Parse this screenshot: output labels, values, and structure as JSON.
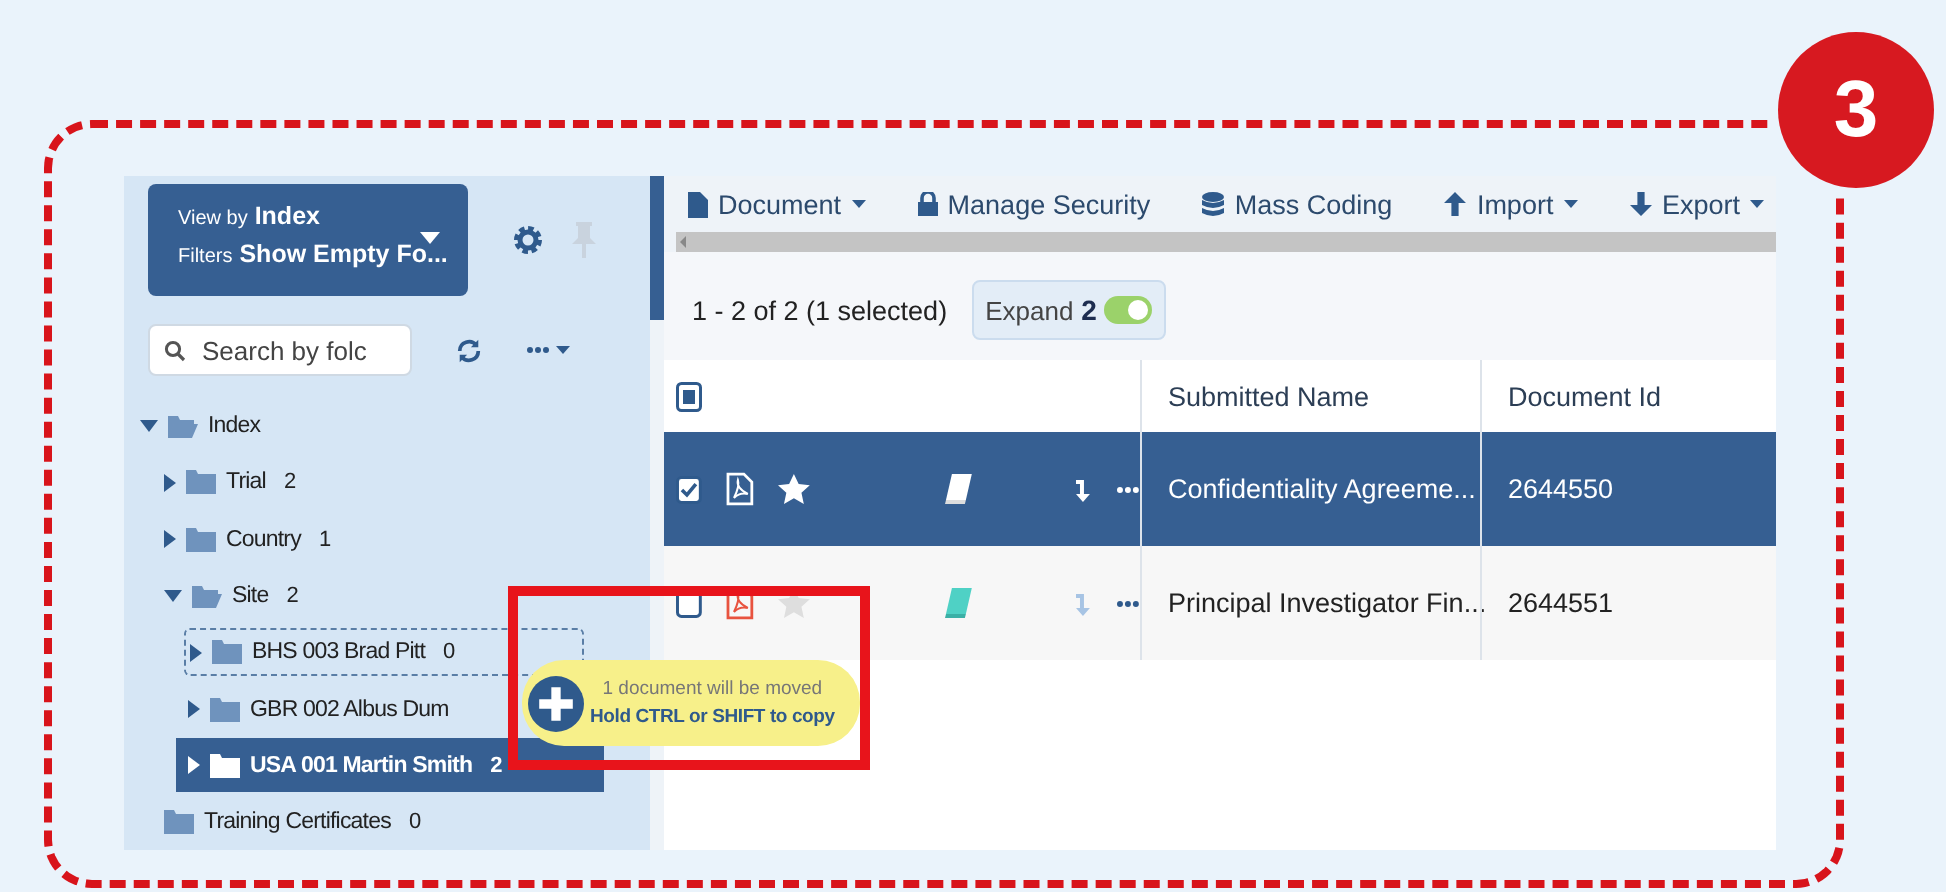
{
  "step_badge": "3",
  "view": {
    "view_by_label": "View by",
    "view_by": "Index",
    "filters_label": "Filters",
    "filters": "Show Empty Fo..."
  },
  "search": {
    "placeholder": "Search by folc"
  },
  "tree": [
    {
      "label": "Index",
      "expanded": true,
      "selected": false,
      "drop_target": false,
      "children": [
        {
          "label": "Trial",
          "count": "2",
          "expanded": false,
          "selected": false,
          "drop_target": false
        },
        {
          "label": "Country",
          "count": "1",
          "expanded": false,
          "selected": false,
          "drop_target": false
        },
        {
          "label": "Site",
          "count": "2",
          "expanded": true,
          "selected": false,
          "drop_target": false,
          "children": [
            {
              "label": "BHS 003 Brad Pitt",
              "count": "0",
              "expanded": false,
              "selected": false,
              "drop_target": true
            },
            {
              "label": "GBR 002 Albus Dum",
              "expanded": false,
              "selected": false,
              "drop_target": false
            },
            {
              "label": "USA 001 Martin Smith",
              "count": "2",
              "expanded": false,
              "selected": true,
              "drop_target": false
            }
          ]
        },
        {
          "label": "Training Certificates",
          "count": "0",
          "selected": false,
          "drop_target": false
        }
      ]
    }
  ],
  "toolbar": [
    {
      "kind": "document",
      "label": "Document",
      "dropdown": true
    },
    {
      "kind": "lock",
      "label": "Manage Security",
      "dropdown": false
    },
    {
      "kind": "database",
      "label": "Mass Coding",
      "dropdown": false
    },
    {
      "kind": "import",
      "label": "Import",
      "dropdown": true
    },
    {
      "kind": "export",
      "label": "Export",
      "dropdown": true
    }
  ],
  "summary": "1 - 2 of 2 (1 selected)",
  "expand": {
    "label": "Expand",
    "count": "2",
    "on": true
  },
  "table": {
    "select_all_partial": true,
    "columns": [
      "Submitted Name",
      "Document Id"
    ],
    "rows": [
      {
        "selected": true,
        "checked": true,
        "starred": true,
        "submitted_name": "Confidentiality Agreeme...",
        "document_id": "2644550"
      },
      {
        "selected": false,
        "checked": false,
        "starred": false,
        "submitted_name": "Principal Investigator Fin...",
        "document_id": "2644551"
      }
    ]
  },
  "drag_tooltip": {
    "line_1": "1 document will be moved",
    "line_2": "Hold CTRL or SHIFT to copy"
  }
}
